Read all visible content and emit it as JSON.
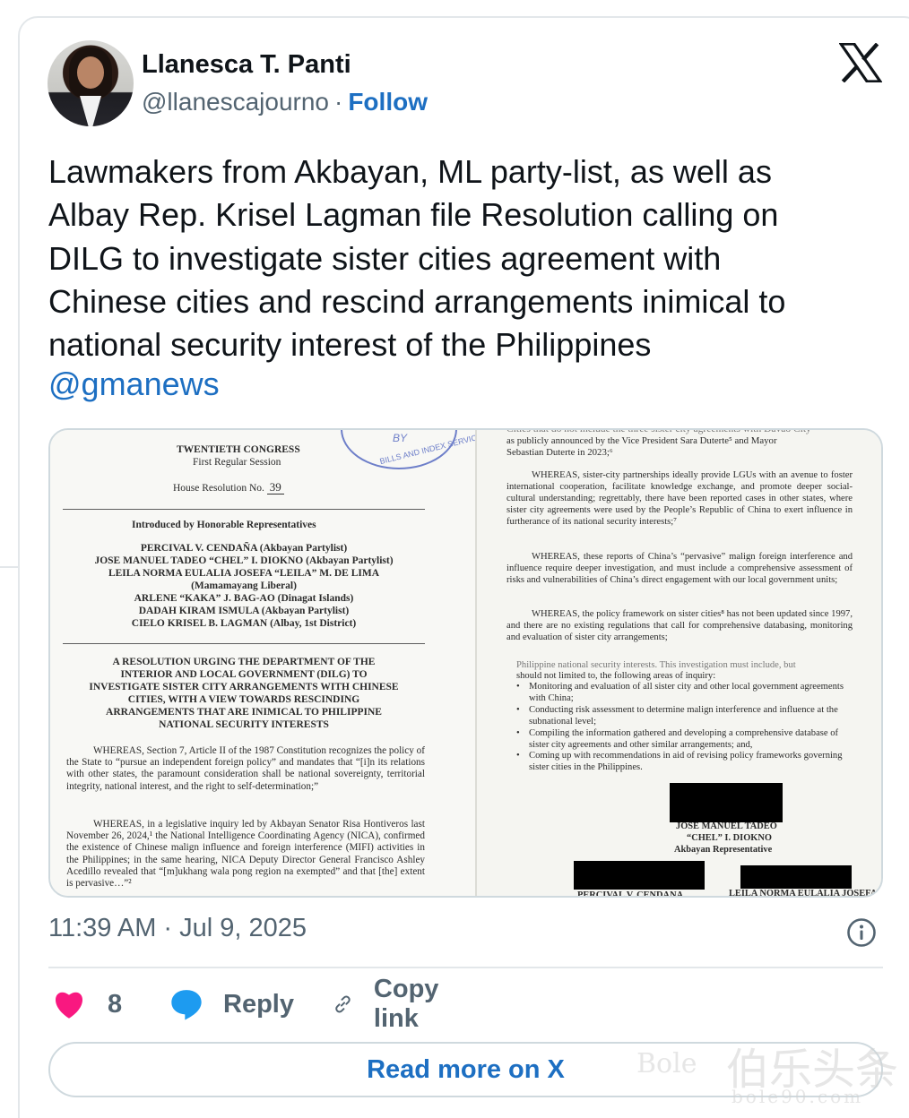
{
  "author": {
    "name": "Llanesca T. Panti",
    "handle": "@llanescajourno",
    "separator": "·",
    "follow_label": "Follow"
  },
  "brand_icon": "x-logo-icon",
  "tweet": {
    "lines": [
      "Lawmakers from Akbayan, ML party-list, as well as",
      "Albay Rep. Krisel Lagman file Resolution calling on",
      "DILG to investigate sister cities agreement with",
      "Chinese cities and rescind arrangements inimical to",
      "national security interest of the Philippines"
    ],
    "mention": "@gmanews"
  },
  "document": {
    "left": {
      "stamp_text": "BILLS AND INDEX SERVICE",
      "stamp_by": "BY",
      "congress": "TWENTIETH CONGRESS",
      "session": "First Regular Session",
      "resolution_label": "House Resolution No.",
      "resolution_no": "39",
      "introduced_by": "Introduced by Honorable Representatives",
      "representatives": [
        "PERCIVAL V. CENDAÑA (Akbayan Partylist)",
        "JOSE MANUEL TADEO “CHEL” I. DIOKNO (Akbayan Partylist)",
        "LEILA NORMA EULALIA JOSEFA “LEILA” M. DE LIMA",
        "(Mamamayang Liberal)",
        "ARLENE “KAKA” J. BAG-AO (Dinagat Islands)",
        "DADAH KIRAM ISMULA (Akbayan Partylist)",
        "CIELO KRISEL B. LAGMAN (Albay, 1st District)"
      ],
      "title_lines": [
        "A RESOLUTION URGING THE DEPARTMENT OF THE",
        "INTERIOR AND LOCAL GOVERNMENT (DILG) TO",
        "INVESTIGATE SISTER CITY ARRANGEMENTS WITH CHINESE",
        "CITIES, WITH A VIEW TOWARDS RESCINDING",
        "ARRANGEMENTS THAT ARE INIMICAL TO PHILIPPINE",
        "NATIONAL SECURITY INTERESTS"
      ],
      "whereas_1": "WHEREAS, Section 7, Article II of the 1987 Constitution recognizes the policy of the State to “pursue an independent foreign policy” and mandates that “[i]n its relations with other states, the paramount consideration shall be national sovereignty, territorial integrity, national interest, and the right to self-determination;”",
      "whereas_2": "WHEREAS, in a legislative inquiry led by Akbayan Senator Risa Hontiveros last November 26, 2024,¹ the National Intelligence Coordinating Agency (NICA), confirmed the existence of Chinese malign influence and foreign interference (MIFI) activities in the Philippines; in the same hearing, NICA Deputy Director General Francisco Ashley Acedillo revealed that “[m]ukhang wala pong region na exempted” and that [the] extent is pervasive…”²"
    },
    "right": {
      "top_cut": "Cities that do not include the three sister city agreements with Davao City",
      "top_1": "as publicly announced by the Vice President Sara Duterte⁵ and Mayor",
      "top_2": "Sebastian Duterte in 2023;⁶",
      "whereas_3": "WHEREAS, sister-city partnerships ideally provide LGUs with an avenue to foster international cooperation, facilitate knowledge exchange, and promote deeper social-cultural understanding; regrettably, there have been reported cases in other states, where sister city agreements were used by the People’s Republic of China to exert influence in furtherance of its national security interests;⁷",
      "whereas_4": "WHEREAS, these reports of China’s “pervasive” malign foreign interference and influence require deeper investigation, and must include a comprehensive assessment of risks and vulnerabilities of China’s direct engagement with our local government units;",
      "whereas_5": "WHEREAS, the policy framework on sister cities⁸ has not been updated since 1997, and there are no existing regulations that call for comprehensive databasing, monitoring and evaluation of sister city arrangements;",
      "cut_line": "Philippine national security interests. This investigation must include, but",
      "list_intro": "should not limited to, the following areas of inquiry:",
      "list": [
        "Monitoring and evaluation of all sister city and other local government agreements with China;",
        "Conducting risk assessment to determine malign interference and influence at the subnational level;",
        "Compiling the information gathered and developing a comprehensive database of sister city agreements and other similar arrangements; and,",
        "Coming up with recommendations in aid of revising policy frameworks governing sister cities in the Philippines."
      ],
      "sig_1": "JOSE MANUEL TADEO",
      "sig_2": "“CHEL” I. DIOKNO",
      "sig_3": "Akbayan Representative",
      "sig_left": "PERCIVAL V. CENDANA",
      "sig_right": "LEILA NORMA EULALIA JOSEFA"
    }
  },
  "meta": {
    "timestamp": "11:39 AM · Jul 9, 2025",
    "info_icon": "info-icon"
  },
  "actions": {
    "like_count": "8",
    "reply_label": "Reply",
    "copy_link_label": "Copy link"
  },
  "read_more_label": "Read more on X",
  "watermark": {
    "logo_text": "Bole",
    "cn_text": "伯乐头条",
    "url_text": "bole90.com"
  },
  "colors": {
    "link_blue": "#1d6fc2",
    "like_pink": "#f91880",
    "reply_blue": "#1d9bf0",
    "muted": "#536471"
  }
}
